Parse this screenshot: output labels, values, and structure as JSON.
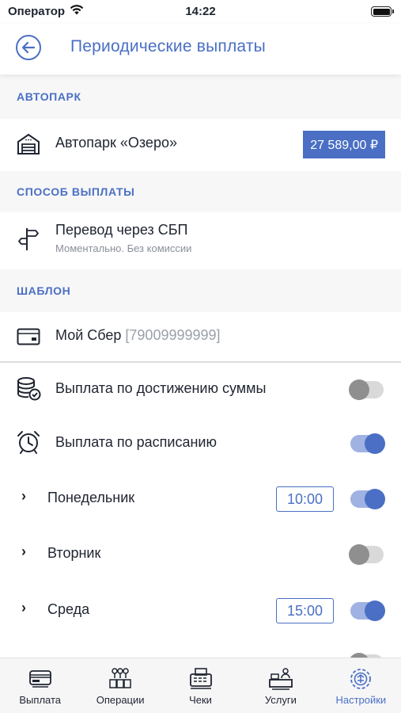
{
  "status_bar": {
    "carrier": "Оператор",
    "time": "14:22"
  },
  "nav": {
    "title": "Периодические выплаты"
  },
  "fleet_section": {
    "header": "АВТОПАРК",
    "name": "Автопарк «Озеро»",
    "amount": "27 589,00 ₽"
  },
  "payout_method_section": {
    "header": "СПОСОБ ВЫПЛАТЫ",
    "method": "Перевод через СБП",
    "description": "Моментально. Без комиссии"
  },
  "template_section": {
    "header": "ШАБЛОН",
    "name": "Мой Сбер",
    "account": "[79009999999]"
  },
  "settings": {
    "threshold_label": "Выплата по достижению суммы",
    "threshold_enabled": false,
    "schedule_label": "Выплата по расписанию",
    "schedule_enabled": true
  },
  "days": [
    {
      "name": "Понедельник",
      "time": "10:00",
      "enabled": true
    },
    {
      "name": "Вторник",
      "time": "",
      "enabled": false
    },
    {
      "name": "Среда",
      "time": "15:00",
      "enabled": true
    }
  ],
  "tab_bar": {
    "tabs": [
      {
        "label": "Выплата",
        "icon": "payout-icon"
      },
      {
        "label": "Операции",
        "icon": "operations-icon"
      },
      {
        "label": "Чеки",
        "icon": "receipts-icon"
      },
      {
        "label": "Услуги",
        "icon": "services-icon"
      },
      {
        "label": "Настройки",
        "icon": "settings-icon"
      }
    ],
    "active_index": 4
  },
  "colors": {
    "accent": "#4a6fc4",
    "toggle_on_track": "#9fb2e2",
    "toggle_off_knob": "#8f8f8f"
  }
}
